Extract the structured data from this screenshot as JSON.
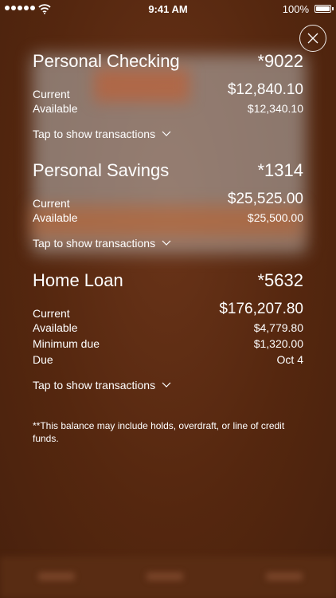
{
  "status_bar": {
    "time": "9:41 AM",
    "battery": "100%"
  },
  "accounts": [
    {
      "name": "Personal Checking",
      "number": "*9022",
      "rows": [
        {
          "label": "Current",
          "value": "$12,840.10"
        },
        {
          "label": "Available",
          "value": "$12,340.10"
        }
      ],
      "tap_label": "Tap to show transactions"
    },
    {
      "name": "Personal Savings",
      "number": "*1314",
      "rows": [
        {
          "label": "Current",
          "value": "$25,525.00"
        },
        {
          "label": "Available",
          "value": "$25,500.00"
        }
      ],
      "tap_label": "Tap to show transactions"
    },
    {
      "name": "Home Loan",
      "number": "*5632",
      "rows": [
        {
          "label": "Current",
          "value": "$176,207.80"
        },
        {
          "label": "Available",
          "value": "$4,779.80"
        },
        {
          "label": "Minimum due",
          "value": "$1,320.00"
        },
        {
          "label": "Due",
          "value": "Oct 4"
        }
      ],
      "tap_label": "Tap to show transactions"
    }
  ],
  "footnote": "**This balance may include holds, overdraft, or line of credit funds.",
  "icons": {
    "close": "close-icon",
    "expand": "chevron-down-icon"
  },
  "colors": {
    "background": "#5a2a12",
    "text": "#ffffff"
  }
}
